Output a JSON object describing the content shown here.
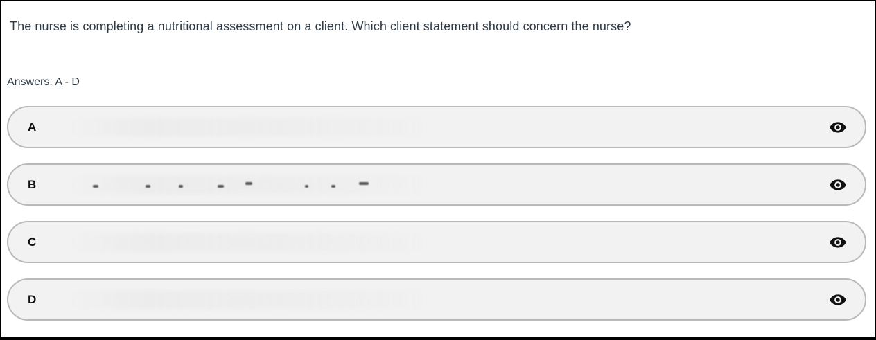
{
  "question": {
    "text": "The nurse is completing a nutritional assessment on a client. Which client statement should concern the nurse?"
  },
  "answers_label": "Answers: A - D",
  "options": [
    {
      "letter": "A",
      "icon": "eye-icon"
    },
    {
      "letter": "B",
      "icon": "eye-icon"
    },
    {
      "letter": "C",
      "icon": "eye-icon"
    },
    {
      "letter": "D",
      "icon": "eye-icon"
    }
  ],
  "colors": {
    "text": "#2f3a44",
    "option_bg": "#f2f2f2",
    "option_border": "#b9b9b9"
  }
}
